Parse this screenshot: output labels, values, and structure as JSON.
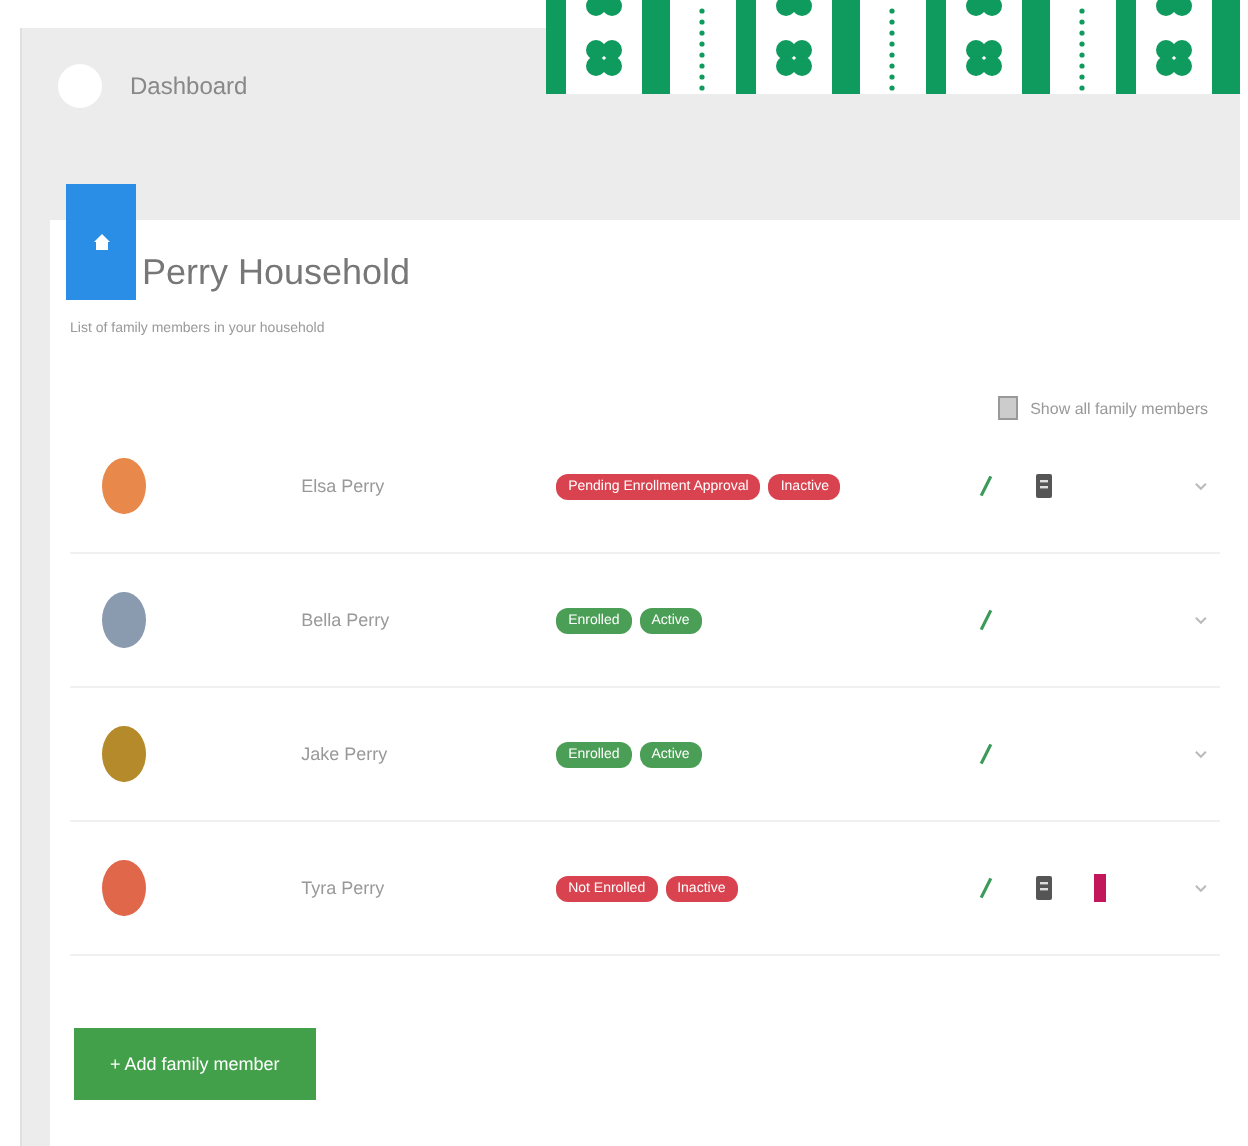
{
  "header": {
    "title": "Dashboard"
  },
  "household": {
    "title": "Perry Household",
    "subtitle": "List of family members in your household",
    "toggle_label": "Show all family members",
    "toggle_on": false
  },
  "members": [
    {
      "name": "Elsa Perry",
      "color": "#e8884a",
      "badges": [
        {
          "label": "Pending Enrollment Approval",
          "color": "#d9434f"
        },
        {
          "label": "Inactive",
          "color": "#d9434f"
        }
      ],
      "has_document": true,
      "flagged": false
    },
    {
      "name": "Bella Perry",
      "color": "#8a9bb0",
      "badges": [
        {
          "label": "Enrolled",
          "color": "#4a9e55"
        },
        {
          "label": "Active",
          "color": "#4a9e55"
        }
      ],
      "has_document": false,
      "flagged": false
    },
    {
      "name": "Jake Perry",
      "color": "#b58a2a",
      "badges": [
        {
          "label": "Enrolled",
          "color": "#4a9e55"
        },
        {
          "label": "Active",
          "color": "#4a9e55"
        }
      ],
      "has_document": false,
      "flagged": false
    },
    {
      "name": "Tyra Perry",
      "color": "#e0674a",
      "badges": [
        {
          "label": "Not Enrolled",
          "color": "#d9434f"
        },
        {
          "label": "Inactive",
          "color": "#d9434f"
        }
      ],
      "has_document": true,
      "flagged": true
    }
  ],
  "add_button": "+ Add family member"
}
